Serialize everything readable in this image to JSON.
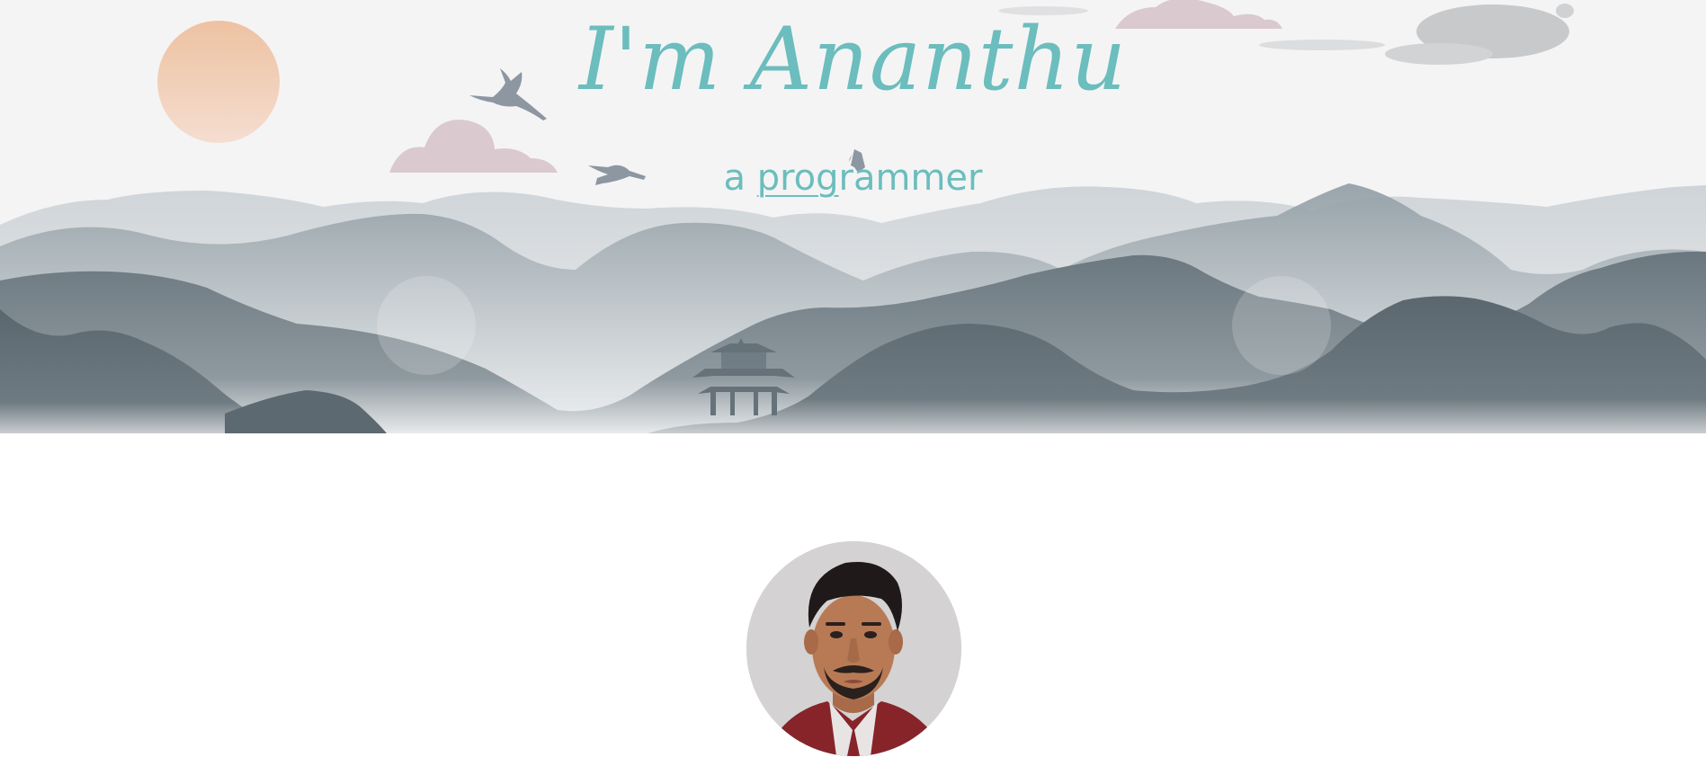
{
  "hero": {
    "title": "I'm Ananthu",
    "subtitle_prefix": "a ",
    "subtitle_underlined": "prog",
    "subtitle_suffix": "rammer"
  },
  "colors": {
    "accent": "#6cbdbd",
    "sun": "#efc4a5",
    "cloud": "#dac9cf",
    "mountain_dark": "#5d6970",
    "mountain_mid": "#8e9ba2",
    "mountain_light": "#c6ccd1",
    "sky": "#f4f4f5"
  },
  "icons": {
    "sun": "sun-icon",
    "bird": "crane-icon",
    "pagoda": "pagoda-icon"
  },
  "profile": {
    "avatar": "profile-photo"
  }
}
